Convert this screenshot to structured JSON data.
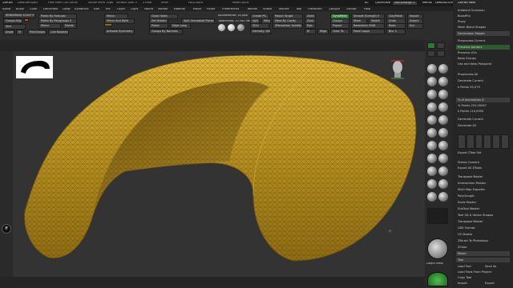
{
  "titlebar": {
    "app": "ZBrush",
    "items": [
      "DefaultProject",
      "Free Mem 130.49GB",
      "Active Mem 1488",
      "Scratch Disk 0",
      "ZTime",
      "Timer",
      "PolyCount",
      "MeshCount"
    ],
    "ac": "AC",
    "quicksave": "QuickSave",
    "seethrough": "See-through 0",
    "menus_label": "Menus",
    "script": "DefaultZScript"
  },
  "menus": [
    "Alpha",
    "Brush",
    "Color",
    "Document",
    "Draw",
    "Dynamics",
    "Edit",
    "File",
    "Layer",
    "Light",
    "Macro",
    "Marker",
    "Material",
    "Movie",
    "Picker",
    "Preferences",
    "Render",
    "Stroke",
    "Texture",
    "Tool",
    "Transform",
    "Zplugin",
    "Zscript",
    "Help"
  ],
  "toolshelf": {
    "rendering": "RENDERING SCULP FILE 8",
    "groups_edge": "Groups Edge",
    "polish_features": "Polish By Features",
    "polish_polygroups": "Polish By Polygroups 0",
    "symmetry_mirror": "Mirror",
    "mirror_weld": "Mirror And Weld",
    "close_holes": "Close Holes",
    "del_hidden": "Del Hidden",
    "split_unmasked": "Split Unmasked Points",
    "activate_symmetry": "Activate Symmetry",
    "groups_normals": "Groups By Normals",
    "active_points": "ActivePoints: 35,088",
    "total_points": "TotalPoints: 37.567 Mil",
    "create_pg": "Create PG",
    "split": "Split",
    "merge": "Merge",
    "sdiv": "SDiv",
    "dynamesh": "DynaMesh",
    "intensity": "Intensity 100",
    "morph_target": "Morph Target",
    "draw_size": "Draw Size 64",
    "focal_shift": "Focal Shift 0",
    "resolution": "Resolution 2048",
    "zadd": "Zadd",
    "zsub": "Zsub",
    "rgb": "Rgb",
    "m": "M",
    "mrgb": "Mrgb",
    "groups": "Groups",
    "project": "Project",
    "clear_to": "Clear To",
    "store": "Store",
    "switch": "Switch",
    "sdiv_num": "Sdiv 1",
    "del_lower": "Del Lower",
    "del_higher": "Del Higher",
    "clay_polish": "Clay Polish",
    "smooth_strength": "Smooth Strength 0",
    "live_boolean": "Live Boolean",
    "angle": "Angle",
    "m_label": "M",
    "polygroups": "PolyGroups",
    "mirror": "Mirror",
    "divide": "Divide",
    "smt": "Smt",
    "suv": "Suv",
    "edge_loop": "Edge Loop",
    "panel_loops": "Panel Loops",
    "blur": "Blur 2",
    "mask_by_cavity": "Mask By Cavity",
    "polish": "Polish",
    "import": "Import",
    "export": "Export",
    "undo": "Undo",
    "redo": "Redo",
    "zremesher": "ZRemesher Solidify",
    "claypolish_btn": "ClayPolish"
  },
  "viewport": {
    "navigation_icon": "ff"
  },
  "rightshelf": {
    "labels": [
      "BPR",
      "SPix 3",
      "Persp",
      "Floor",
      "Local",
      "Frame",
      "Move",
      "Scale",
      "Rotate",
      "Line Fill",
      "PolyF",
      "Transp",
      "Solo",
      "Xpose"
    ],
    "brush_labels": [
      "Standard",
      "Move",
      "ClayBuildup",
      "DamStandard",
      "hPolish",
      "Inflate",
      "Pinch",
      "TrimDynamic",
      "SnakeHook",
      "Smooth",
      "Move Topo",
      "ZModeler",
      "Slash3",
      "CurveTube",
      "Orb Cracks",
      "Dam Standard",
      "Crease"
    ]
  },
  "palette": {
    "header": "ZBrush Next",
    "items": [
      "Ambient Occlusion",
      "BoostPro",
      "Proxy",
      "Mesh Blend Shapes",
      "Decimation Master",
      "Preprocess Current",
      "Preserve borders",
      "Preserve UVs",
      "Keep Groups",
      "Use and Keep Polypaint",
      "Preprocess All",
      "Decimate Current",
      "k Points 35,079",
      "% of decimation 8",
      "% Points 225,00047",
      "k Points 110,0050",
      "Decimate Current",
      "Decimate All",
      "Export ZTool Set",
      "Stereo Camera",
      "Export All ZTools",
      "Transpose Master",
      "Intersection Masker",
      "Multi Map Exporter",
      "PolyGroupIt",
      "Scale Master",
      "SubTool Master",
      "Text 3D & Vector Shapes",
      "Transpose Master",
      "UDS Format",
      "UV Master",
      "ZBrush To Photoshop",
      "ZColor",
      "Movie",
      "Tool",
      "Load Tool",
      "Save As",
      "Load Tools From Project",
      "Copy Tool",
      "Import",
      "Export"
    ]
  },
  "bottombar": {
    "depth_mask": "Depth Mask",
    "zoom": "Zoom"
  }
}
